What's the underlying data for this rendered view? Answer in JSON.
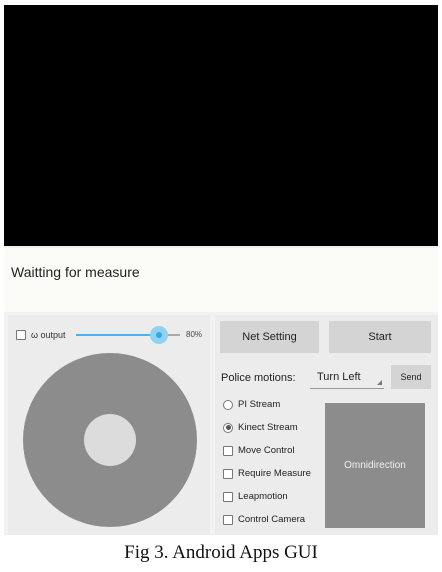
{
  "status": {
    "text": "Waitting for measure"
  },
  "control": {
    "omega_output_label": "ω output",
    "omega_output_checked": false,
    "speed_slider": {
      "value_percent": 80,
      "label": "80%"
    }
  },
  "toolbar": {
    "net_setting_label": "Net Setting",
    "start_label": "Start",
    "send_label": "Send"
  },
  "police_motions": {
    "label": "Police motions:",
    "selected": "Turn Left"
  },
  "options": {
    "stream_radios": [
      {
        "label": "PI Stream",
        "selected": false
      },
      {
        "label": "Kinect Stream",
        "selected": true
      }
    ],
    "checkboxes": [
      {
        "label": "Move Control",
        "checked": false
      },
      {
        "label": "Require Measure",
        "checked": false
      },
      {
        "label": "Leapmotion",
        "checked": false
      },
      {
        "label": "Control Camera",
        "checked": false
      }
    ]
  },
  "omni_button_label": "Omnidirection",
  "caption": "Fig 3. Android Apps GUI",
  "colors": {
    "video_bg": "#000000",
    "slider_accent": "#3aa6e0",
    "joystick": "#8c8c8c",
    "button": "#d4d4d4"
  }
}
